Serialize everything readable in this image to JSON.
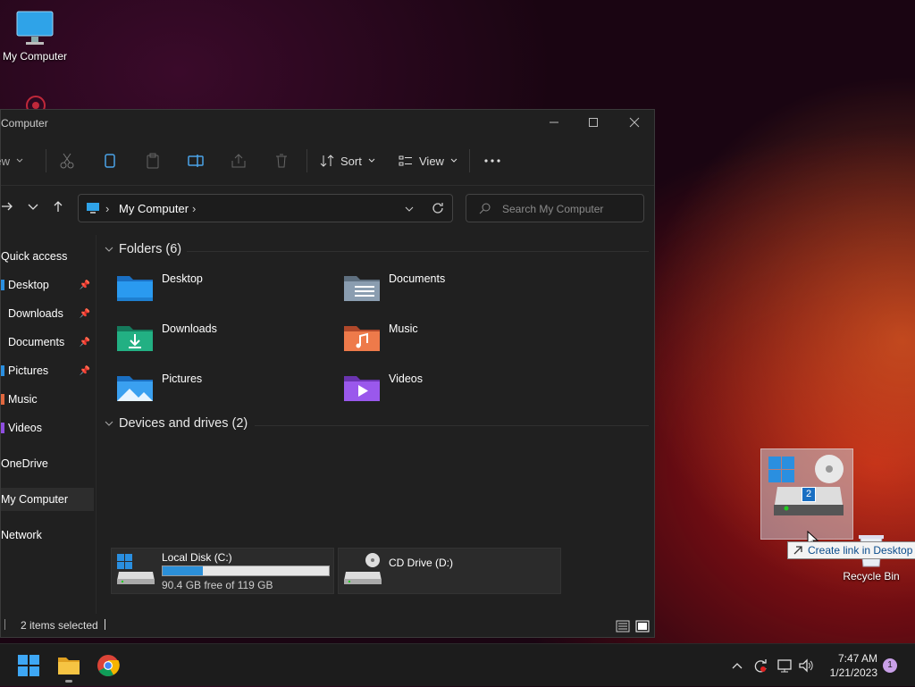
{
  "desktop": {
    "my_computer_label": "My Computer",
    "recycle_bin_label": "Recycle Bin"
  },
  "window": {
    "title": "Computer",
    "toolbar": {
      "new_label": "New",
      "sort_label": "Sort",
      "view_label": "View"
    },
    "address": {
      "location": "My Computer",
      "search_placeholder": "Search My Computer"
    },
    "sidebar": {
      "items": [
        {
          "label": "Quick access"
        },
        {
          "label": "Desktop",
          "pinned": true
        },
        {
          "label": "Downloads",
          "pinned": true
        },
        {
          "label": "Documents",
          "pinned": true
        },
        {
          "label": "Pictures",
          "pinned": true
        },
        {
          "label": "Music"
        },
        {
          "label": "Videos"
        },
        {
          "label": "OneDrive"
        },
        {
          "label": "My Computer",
          "selected": true
        },
        {
          "label": "Network"
        }
      ]
    },
    "folders_header": "Folders (6)",
    "folders": [
      {
        "name": "Desktop",
        "icon": "desktop-folder-icon",
        "color": "#1e8ee0"
      },
      {
        "name": "Documents",
        "icon": "documents-folder-icon",
        "color": "#7f93a8"
      },
      {
        "name": "Downloads",
        "icon": "downloads-folder-icon",
        "color": "#1fa37a"
      },
      {
        "name": "Music",
        "icon": "music-folder-icon",
        "color": "#e0673e"
      },
      {
        "name": "Pictures",
        "icon": "pictures-folder-icon",
        "color": "#2a8fe0"
      },
      {
        "name": "Videos",
        "icon": "videos-folder-icon",
        "color": "#8f4ee0"
      }
    ],
    "drives_header": "Devices and drives (2)",
    "drives": [
      {
        "name": "Local Disk (C:)",
        "free_text": "90.4 GB free of 119 GB",
        "used_fraction": 0.24
      },
      {
        "name": "CD Drive (D:)"
      }
    ],
    "status_text": "2 items selected"
  },
  "drag": {
    "count_badge": "2",
    "tooltip": "Create link in Desktop"
  },
  "taskbar": {
    "time": "7:47 AM",
    "date": "1/21/2023",
    "notification_count": "1"
  }
}
